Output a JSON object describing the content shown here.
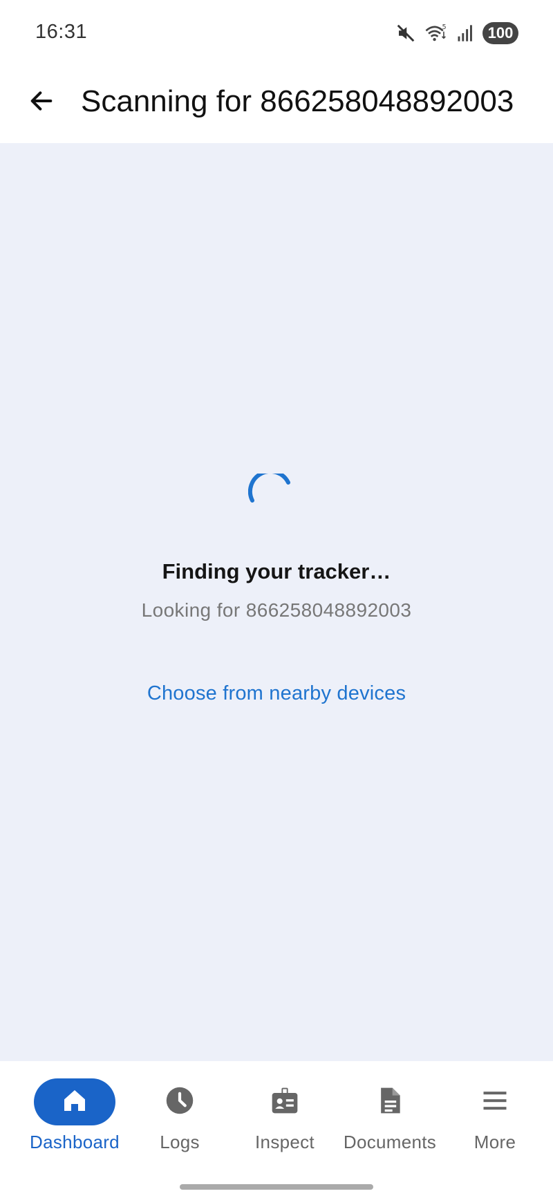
{
  "status_bar": {
    "time": "16:31",
    "battery": "100",
    "icons": [
      "mute-icon",
      "wifi-icon",
      "signal-icon"
    ]
  },
  "app_bar": {
    "title": "Scanning for 866258048892003",
    "back_icon": "arrow-left-icon"
  },
  "main": {
    "spinner_icon": "loading-spinner-icon",
    "heading": "Finding your tracker…",
    "subtext": "Looking for 866258048892003",
    "link": "Choose from nearby devices"
  },
  "bottom_nav": {
    "items": [
      {
        "label": "Dashboard",
        "icon": "home-icon",
        "active": true
      },
      {
        "label": "Logs",
        "icon": "clock-icon",
        "active": false
      },
      {
        "label": "Inspect",
        "icon": "id-badge-icon",
        "active": false
      },
      {
        "label": "Documents",
        "icon": "document-icon",
        "active": false
      },
      {
        "label": "More",
        "icon": "menu-icon",
        "active": false
      }
    ]
  },
  "colors": {
    "accent": "#1a64c8",
    "link": "#1f74cf",
    "background": "#edf0f9",
    "inactive": "#666666"
  }
}
